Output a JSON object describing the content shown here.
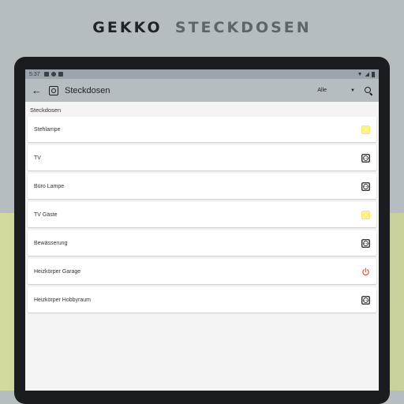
{
  "banner": {
    "brand": "GEKKO",
    "subtitle": "STECKDOSEN"
  },
  "statusbar": {
    "time": "5:37"
  },
  "toolbar": {
    "title": "Steckdosen",
    "filter": "Alle"
  },
  "section_title": "Steckdosen",
  "colors": {
    "active": "#f3e55c",
    "power": "#e0584b",
    "icon": "#222222"
  },
  "items": [
    {
      "label": "Stehlampe",
      "icon": "socket-on-icon"
    },
    {
      "label": "TV",
      "icon": "socket-off-icon"
    },
    {
      "label": "Büro Lampe",
      "icon": "socket-off-icon"
    },
    {
      "label": "TV Gäste",
      "icon": "socket-on-icon"
    },
    {
      "label": "Bewässerung",
      "icon": "socket-off-icon"
    },
    {
      "label": "Heizkörper Garage",
      "icon": "power-icon"
    },
    {
      "label": "Heizkörper Hobbyraum",
      "icon": "socket-off-icon"
    }
  ]
}
